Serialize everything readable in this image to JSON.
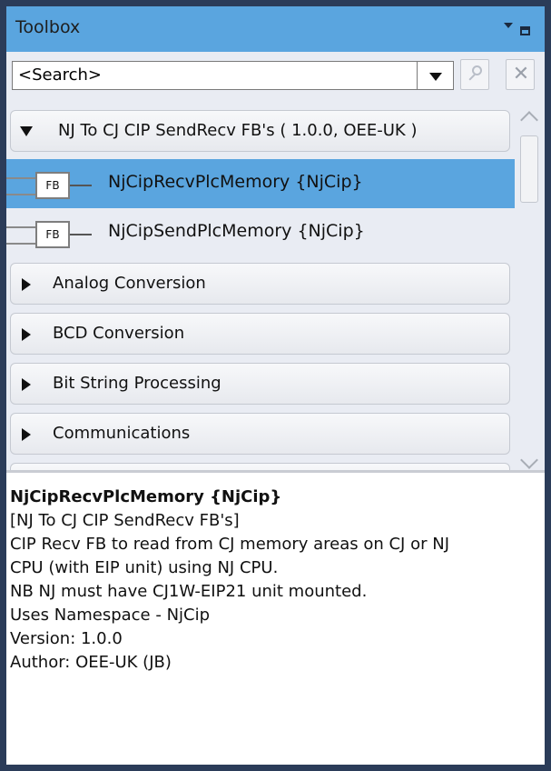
{
  "toolbox": {
    "title": "Toolbox"
  },
  "search": {
    "value": "<Search>"
  },
  "list": {
    "expanded_group": "NJ To CJ CIP SendRecv FB's ( 1.0.0, OEE-UK )",
    "function_blocks": [
      {
        "icon": "FB",
        "name": "NjCipRecvPlcMemory {NjCip}",
        "selected": true
      },
      {
        "icon": "FB",
        "name": "NjCipSendPlcMemory {NjCip}",
        "selected": false
      }
    ],
    "collapsed_groups": [
      "Analog Conversion",
      "BCD Conversion",
      "Bit String Processing",
      "Communications"
    ]
  },
  "info": {
    "title": "NjCipRecvPlcMemory {NjCip}",
    "lines": [
      "[NJ To CJ CIP SendRecv FB's]",
      "CIP Recv FB to read from CJ memory areas on CJ or NJ",
      "CPU (with EIP unit) using NJ CPU.",
      "NB NJ must have CJ1W-EIP21 unit mounted.",
      "Uses Namespace - NjCip",
      "Version: 1.0.0",
      "Author: OEE-UK (JB)"
    ]
  },
  "colors": {
    "title_bar": "#5aa5df",
    "selection": "#5aa5df",
    "frame": "#2b3c59"
  }
}
